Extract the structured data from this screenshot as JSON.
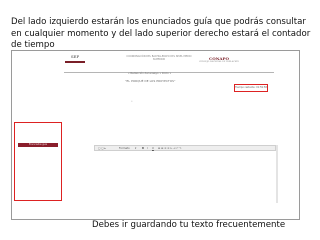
{
  "intro_text": "Del lado izquierdo estarán los enunciados guía que podrás consultar en cualquier momento y del lado superior derecho estará el contador de tiempo",
  "page_header": {
    "logo_left": "SEP",
    "header_text": "COORDINACIÓN DEL BACHILLERATO DEL NIVEL MEDIO SUPERIOR",
    "logo_right": "CONAPO",
    "logo_right_sub": "CONSEJO NACIONAL DE POBLACIÓN"
  },
  "nav_text": "« Redacción del ensayo » Inicio »",
  "essay_title": "“EL PORQUÉ DE LOS PROYECTOS”",
  "counter_text": "Tiempo restante: 01:59:58",
  "guide_button_label": "Enunciados guía",
  "toolbar": {
    "font_label": "Formato",
    "bold_icon": "B",
    "italic_icon": "I",
    "underline_icon": "U"
  },
  "bottom_note": "Debes ir guardando tu texto frecuentemente",
  "colors": {
    "highlight_red": "#dd2222",
    "brand_maroon": "#8a1e2b"
  }
}
